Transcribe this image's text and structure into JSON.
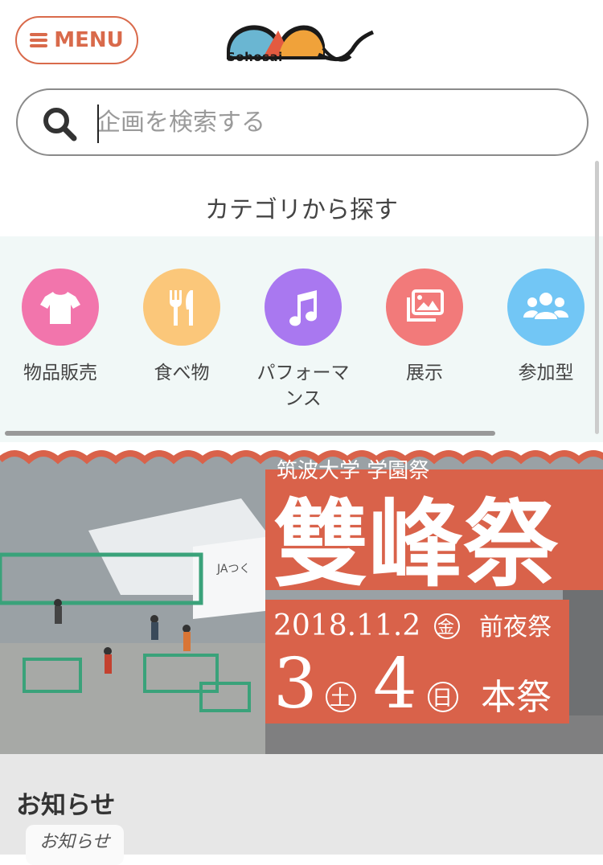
{
  "header": {
    "menu_label": "MENU",
    "logo_text": "Sohosai"
  },
  "search": {
    "placeholder": "企画を検索する",
    "value": ""
  },
  "categories": {
    "heading": "カテゴリから探す",
    "items": [
      {
        "label": "物品販売",
        "icon": "tshirt-icon",
        "color": "#f275ac"
      },
      {
        "label": "食べ物",
        "icon": "utensils-icon",
        "color": "#fbc77a"
      },
      {
        "label": "パフォーマンス",
        "icon": "music-icon",
        "color": "#a978f0"
      },
      {
        "label": "展示",
        "icon": "images-icon",
        "color": "#f27a7a"
      },
      {
        "label": "参加型",
        "icon": "users-icon",
        "color": "#72c6f5"
      }
    ]
  },
  "banner": {
    "subtitle": "筑波大学 学園祭",
    "title": "雙峰祭",
    "date_line": "2018.11.2",
    "date_day1": "金",
    "eve_label": "前夜祭",
    "day_a": "3",
    "day_a_weekday": "土",
    "day_b": "4",
    "day_b_weekday": "日",
    "main_label": "本祭",
    "tent_sign": "JAつく",
    "accent_color": "#d9624a"
  },
  "notice": {
    "title": "お知らせ",
    "tag": "お知らせ"
  }
}
